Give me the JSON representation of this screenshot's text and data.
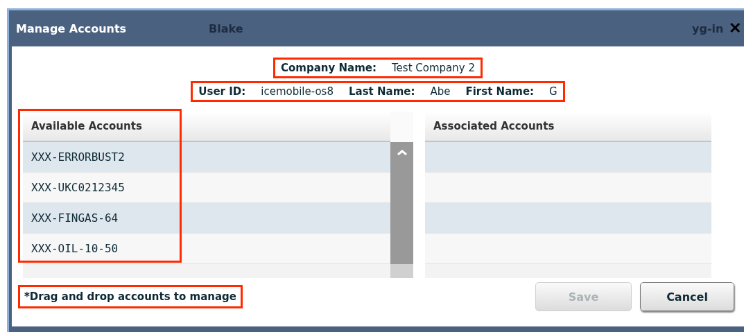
{
  "window": {
    "title": "Manage Accounts",
    "ghost_texts": [
      "Blake",
      "yg-in"
    ],
    "close": "✕"
  },
  "company": {
    "label": "Company Name:",
    "value": "Test Company 2",
    "highlighted": true
  },
  "user": {
    "highlighted": true,
    "fields": [
      {
        "label": "User ID:",
        "value": "icemobile-os8"
      },
      {
        "label": "Last Name:",
        "value": "Abe"
      },
      {
        "label": "First Name:",
        "value": "G"
      }
    ]
  },
  "available_accounts": {
    "heading": "Available Accounts",
    "highlighted": true,
    "rows": [
      "XXX-ERRORBUST2",
      "XXX-UKC0212345",
      "XXX-FINGAS-64",
      "XXX-OIL-10-50"
    ]
  },
  "associated_accounts": {
    "heading": "Associated Accounts"
  },
  "hint": {
    "text": "*Drag and drop accounts to manage",
    "highlighted": true
  },
  "buttons": [
    {
      "label": "Save",
      "disabled": true
    },
    {
      "label": "Cancel",
      "disabled": false
    }
  ]
}
